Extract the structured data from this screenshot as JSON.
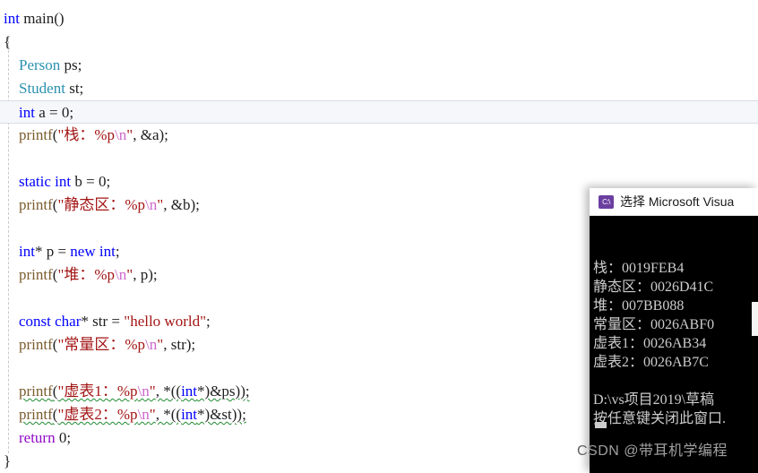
{
  "editor": {
    "language": "cpp",
    "current_line_index": 4,
    "lines": [
      {
        "indent": 0,
        "tokens": [
          {
            "t": "int",
            "c": "kw"
          },
          {
            "t": " ",
            "c": "plain"
          },
          {
            "t": "main",
            "c": "plain"
          },
          {
            "t": "()",
            "c": "plain"
          }
        ]
      },
      {
        "indent": 0,
        "tokens": [
          {
            "t": "{",
            "c": "plain"
          }
        ]
      },
      {
        "indent": 1,
        "tokens": [
          {
            "t": "Person",
            "c": "type"
          },
          {
            "t": " ps;",
            "c": "plain"
          }
        ]
      },
      {
        "indent": 1,
        "tokens": [
          {
            "t": "Student",
            "c": "type"
          },
          {
            "t": " st;",
            "c": "plain"
          }
        ]
      },
      {
        "indent": 1,
        "tokens": [
          {
            "t": "int",
            "c": "kw"
          },
          {
            "t": " a = ",
            "c": "plain"
          },
          {
            "t": "0",
            "c": "num"
          },
          {
            "t": ";",
            "c": "plain"
          }
        ]
      },
      {
        "indent": 1,
        "tokens": [
          {
            "t": "printf",
            "c": "fn"
          },
          {
            "t": "(",
            "c": "plain"
          },
          {
            "t": "\"栈：%p",
            "c": "str"
          },
          {
            "t": "\\n",
            "c": "esc"
          },
          {
            "t": "\"",
            "c": "str"
          },
          {
            "t": ", &a);",
            "c": "plain"
          }
        ]
      },
      {
        "indent": 0,
        "tokens": []
      },
      {
        "indent": 1,
        "tokens": [
          {
            "t": "static",
            "c": "kw"
          },
          {
            "t": " ",
            "c": "plain"
          },
          {
            "t": "int",
            "c": "kw"
          },
          {
            "t": " b = ",
            "c": "plain"
          },
          {
            "t": "0",
            "c": "num"
          },
          {
            "t": ";",
            "c": "plain"
          }
        ]
      },
      {
        "indent": 1,
        "tokens": [
          {
            "t": "printf",
            "c": "fn"
          },
          {
            "t": "(",
            "c": "plain"
          },
          {
            "t": "\"静态区：%p",
            "c": "str"
          },
          {
            "t": "\\n",
            "c": "esc"
          },
          {
            "t": "\"",
            "c": "str"
          },
          {
            "t": ", &b);",
            "c": "plain"
          }
        ]
      },
      {
        "indent": 0,
        "tokens": []
      },
      {
        "indent": 1,
        "tokens": [
          {
            "t": "int",
            "c": "kw"
          },
          {
            "t": "* p = ",
            "c": "plain"
          },
          {
            "t": "new",
            "c": "kw"
          },
          {
            "t": " ",
            "c": "plain"
          },
          {
            "t": "int",
            "c": "kw"
          },
          {
            "t": ";",
            "c": "plain"
          }
        ]
      },
      {
        "indent": 1,
        "tokens": [
          {
            "t": "printf",
            "c": "fn"
          },
          {
            "t": "(",
            "c": "plain"
          },
          {
            "t": "\"堆：%p",
            "c": "str"
          },
          {
            "t": "\\n",
            "c": "esc"
          },
          {
            "t": "\"",
            "c": "str"
          },
          {
            "t": ", p);",
            "c": "plain"
          }
        ]
      },
      {
        "indent": 0,
        "tokens": []
      },
      {
        "indent": 1,
        "tokens": [
          {
            "t": "const",
            "c": "kw"
          },
          {
            "t": " ",
            "c": "plain"
          },
          {
            "t": "char",
            "c": "kw"
          },
          {
            "t": "* str = ",
            "c": "plain"
          },
          {
            "t": "\"hello world\"",
            "c": "str"
          },
          {
            "t": ";",
            "c": "plain"
          }
        ]
      },
      {
        "indent": 1,
        "tokens": [
          {
            "t": "printf",
            "c": "fn"
          },
          {
            "t": "(",
            "c": "plain"
          },
          {
            "t": "\"常量区：%p",
            "c": "str"
          },
          {
            "t": "\\n",
            "c": "esc"
          },
          {
            "t": "\"",
            "c": "str"
          },
          {
            "t": ", str);",
            "c": "plain"
          }
        ]
      },
      {
        "indent": 0,
        "tokens": []
      },
      {
        "indent": 1,
        "error": true,
        "tokens": [
          {
            "t": "printf",
            "c": "fn"
          },
          {
            "t": "(",
            "c": "plain"
          },
          {
            "t": "\"虚表1：%p",
            "c": "str"
          },
          {
            "t": "\\n",
            "c": "esc"
          },
          {
            "t": "\"",
            "c": "str"
          },
          {
            "t": ", *((",
            "c": "plain"
          },
          {
            "t": "int",
            "c": "kw"
          },
          {
            "t": "*)&ps));",
            "c": "plain"
          }
        ]
      },
      {
        "indent": 1,
        "error": true,
        "tokens": [
          {
            "t": "printf",
            "c": "fn"
          },
          {
            "t": "(",
            "c": "plain"
          },
          {
            "t": "\"虚表2：%p",
            "c": "str"
          },
          {
            "t": "\\n",
            "c": "esc"
          },
          {
            "t": "\"",
            "c": "str"
          },
          {
            "t": ", *((",
            "c": "plain"
          },
          {
            "t": "int",
            "c": "kw"
          },
          {
            "t": "*)&st));",
            "c": "plain"
          }
        ]
      },
      {
        "indent": 1,
        "tokens": [
          {
            "t": "return",
            "c": "kw2"
          },
          {
            "t": " ",
            "c": "plain"
          },
          {
            "t": "0",
            "c": "num"
          },
          {
            "t": ";",
            "c": "plain"
          }
        ]
      },
      {
        "indent": 0,
        "tokens": [
          {
            "t": "}",
            "c": "plain"
          }
        ]
      }
    ]
  },
  "console": {
    "icon": "cmd-console-icon",
    "title": "选择 Microsoft Visua",
    "output_lines": [
      "栈：0019FEB4",
      "静态区：0026D41C",
      "堆：007BB088",
      "常量区：0026ABF0",
      "虚表1：0026AB34",
      "虚表2：0026AB7C",
      "",
      "D:\\vs项目2019\\草稿",
      "按任意键关闭此窗口."
    ]
  },
  "watermark": {
    "text": "CSDN @带耳机学编程"
  },
  "colors": {
    "keyword": "#0000ff",
    "keyword_control": "#8f08c4",
    "type": "#2b91af",
    "function": "#7a5c2e",
    "string": "#a31515",
    "escape": "#cc66cc",
    "plain": "#202020",
    "error_squiggle": "#1f8a30",
    "editor_background": "#ffffff",
    "console_background": "#000000",
    "console_text": "#cccccc",
    "current_line_background": "#f6f7fb"
  }
}
